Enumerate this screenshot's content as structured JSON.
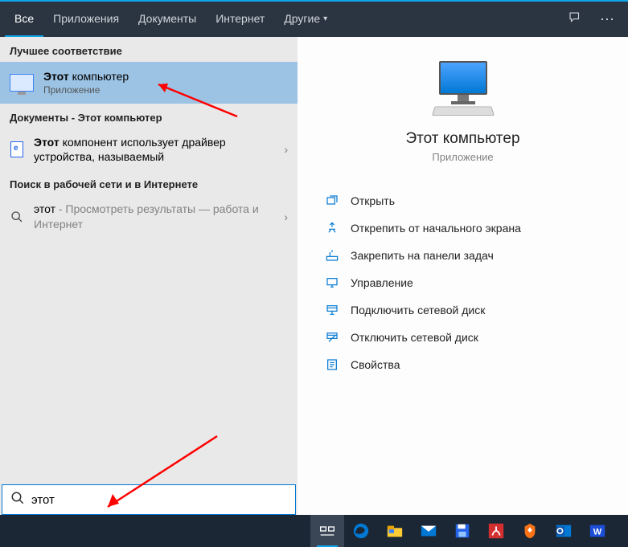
{
  "tabs": {
    "all": "Все",
    "apps": "Приложения",
    "docs": "Документы",
    "web": "Интернет",
    "more": "Другие"
  },
  "left": {
    "best_header": "Лучшее соответствие",
    "best_title_bold": "Этот",
    "best_title_rest": " компьютер",
    "best_sub": "Приложение",
    "docs_header": "Документы - Этот компьютер",
    "doc_item_bold": "Этот",
    "doc_item_rest": " компонент использует драйвер устройства, называемый",
    "web_header": "Поиск в рабочей сети и в Интернете",
    "web_prefix": "этот",
    "web_rest": " - Просмотреть результаты — работа и Интернет"
  },
  "preview": {
    "title": "Этот компьютер",
    "subtitle": "Приложение",
    "actions": {
      "open": "Открыть",
      "unpin_start": "Открепить от начального экрана",
      "pin_taskbar": "Закрепить на панели задач",
      "manage": "Управление",
      "map_drive": "Подключить сетевой диск",
      "unmap_drive": "Отключить сетевой диск",
      "properties": "Свойства"
    }
  },
  "search": {
    "value": "этот"
  }
}
